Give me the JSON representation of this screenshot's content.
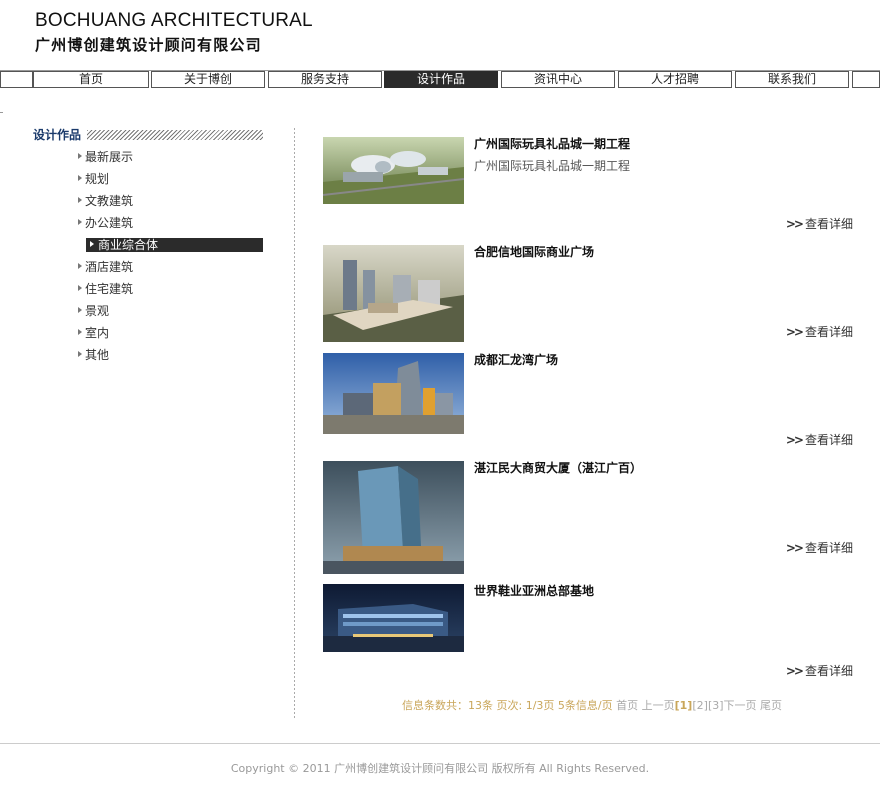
{
  "header": {
    "logo_en": "BOCHUANG ARCHITECTURAL",
    "logo_cn": "广州博创建筑设计顾问有限公司"
  },
  "nav": {
    "items": [
      {
        "label": "首页"
      },
      {
        "label": "关于博创"
      },
      {
        "label": "服务支持"
      },
      {
        "label": "设计作品",
        "active": true
      },
      {
        "label": "资讯中心"
      },
      {
        "label": "人才招聘"
      },
      {
        "label": "联系我们"
      }
    ]
  },
  "sidebar": {
    "title": "设计作品",
    "items": [
      {
        "label": "最新展示"
      },
      {
        "label": "规划"
      },
      {
        "label": "文教建筑"
      },
      {
        "label": "办公建筑"
      },
      {
        "label": "商业综合体",
        "active": true
      },
      {
        "label": "酒店建筑"
      },
      {
        "label": "住宅建筑"
      },
      {
        "label": "景观"
      },
      {
        "label": "室内"
      },
      {
        "label": "其他"
      }
    ]
  },
  "projects": [
    {
      "title": "广州国际玩具礼品城一期工程",
      "desc": "广州国际玩具礼品城一期工程",
      "detail": "查看详细",
      "thumb_icon": "building-rendering"
    },
    {
      "title": "合肥信地国际商业广场",
      "desc": "",
      "detail": "查看详细",
      "thumb_icon": "building-rendering"
    },
    {
      "title": "成都汇龙湾广场",
      "desc": "",
      "detail": "查看详细",
      "thumb_icon": "building-rendering"
    },
    {
      "title": "湛江民大商贸大厦（湛江广百）",
      "desc": "",
      "detail": "查看详细",
      "thumb_icon": "building-rendering"
    },
    {
      "title": "世界鞋业亚洲总部基地",
      "desc": "",
      "detail": "查看详细",
      "thumb_icon": "building-rendering"
    }
  ],
  "pager": {
    "total": "信息条数共：13条",
    "pages": "页次: 1/3页",
    "per_page": "5条信息/页",
    "first": "首页",
    "prev": "上一页",
    "p1": "[1]",
    "p2": "[2]",
    "p3": "[3]",
    "next": "下一页",
    "last": "尾页"
  },
  "footer": {
    "copyright": "Copyright © 2011 广州博创建筑设计顾问有限公司 版权所有 All Rights Reserved."
  },
  "colors": {
    "accent_dark": "#2b2b2b",
    "sidebar_title": "#1a3a6b",
    "pager_gold": "#c9a65a"
  }
}
